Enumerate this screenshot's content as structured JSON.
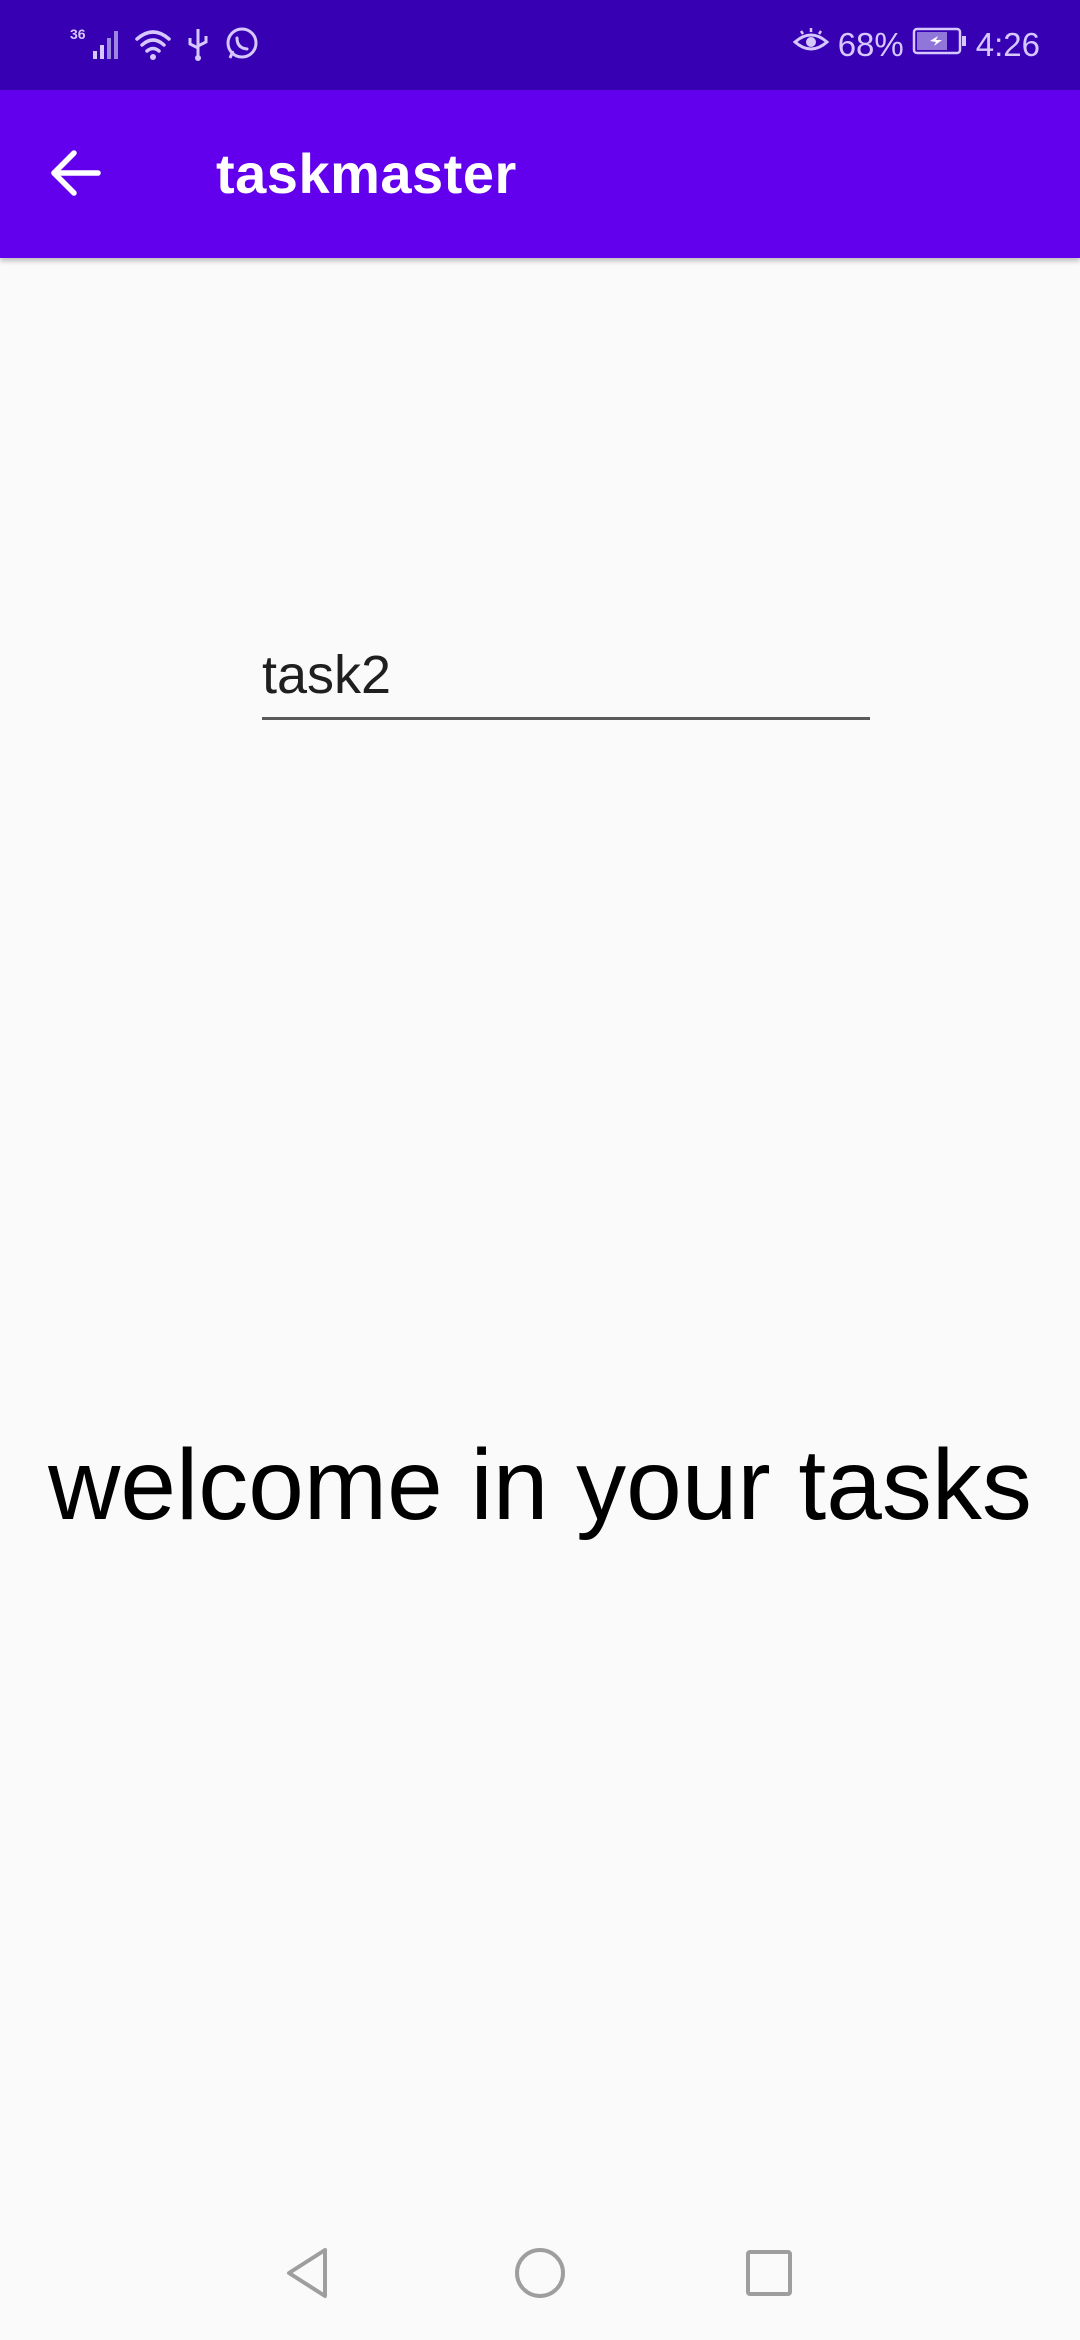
{
  "status_bar": {
    "network_label": "36",
    "battery_percent": "68%",
    "time": "4:26",
    "icons": [
      "signal-icon",
      "wifi-icon",
      "usb-icon",
      "whatsapp-icon",
      "eye-comfort-icon",
      "battery-icon"
    ]
  },
  "app_bar": {
    "title": "taskmaster",
    "back_icon": "arrow-left-icon",
    "color": "#6200ee"
  },
  "task_input": {
    "value": "task2"
  },
  "main": {
    "welcome": "welcome in your tasks"
  },
  "nav_bar": {
    "icons": [
      "back-triangle-icon",
      "home-circle-icon",
      "recents-square-icon"
    ]
  },
  "colors": {
    "status_bar": "#3700b3",
    "app_bar": "#6200ee",
    "background": "#fafafa"
  }
}
